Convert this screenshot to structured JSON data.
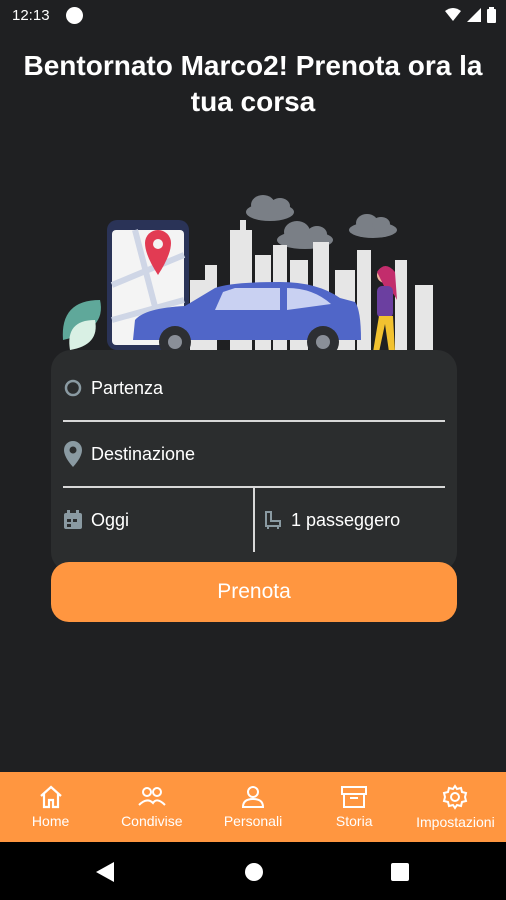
{
  "status_bar": {
    "time": "12:13"
  },
  "header": {
    "title": "Bentornato Marco2! Prenota ora la tua corsa"
  },
  "form": {
    "departure_placeholder": "Partenza",
    "destination_placeholder": "Destinazione",
    "date_value": "Oggi",
    "passengers_value": "1 passeggero",
    "submit_label": "Prenota"
  },
  "bottom_nav": {
    "items": [
      {
        "label": "Home",
        "icon": "home-icon"
      },
      {
        "label": "Condivise",
        "icon": "group-icon"
      },
      {
        "label": "Personali",
        "icon": "person-icon"
      },
      {
        "label": "Storia",
        "icon": "archive-icon"
      },
      {
        "label": "Impostazioni",
        "icon": "gear-icon"
      }
    ]
  },
  "colors": {
    "accent": "#ff9640",
    "background": "#1f2022",
    "card": "#2b2d2e"
  }
}
